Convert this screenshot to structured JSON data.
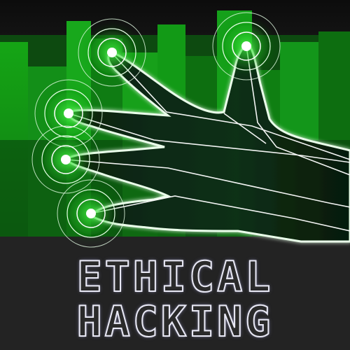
{
  "title": {
    "line1": "ETHICAL",
    "line2": "HACKING"
  },
  "colors": {
    "neon_green": "#33ff33",
    "glow_white": "#e6ffe6",
    "hand_fill": "#0a1a0c",
    "backdrop_dark": "#1c1c1c"
  },
  "icons": {
    "fingertip_rings": "concentric-ring-touch-icon",
    "hand": "circuit-hand-illustration"
  }
}
